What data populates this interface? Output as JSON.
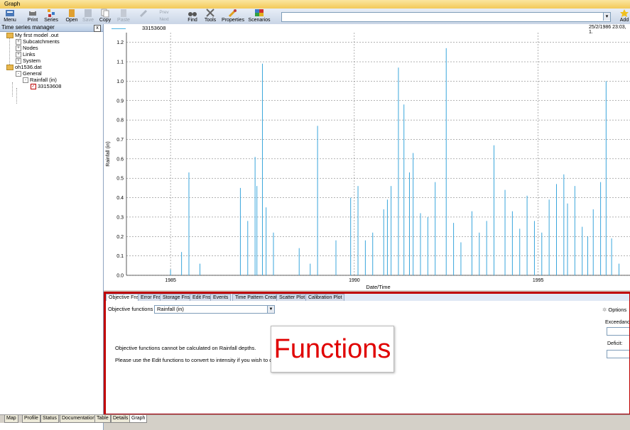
{
  "window": {
    "title": "Graph"
  },
  "toolbar": {
    "buttons": [
      {
        "label": "Menu",
        "icon": "menu-icon"
      },
      {
        "label": "Print",
        "icon": "print-icon"
      },
      {
        "label": "Series",
        "icon": "series-icon"
      },
      {
        "label": "Open",
        "icon": "open-icon"
      },
      {
        "label": "Save",
        "icon": "save-icon"
      },
      {
        "label": "Copy",
        "icon": "copy-icon"
      },
      {
        "label": "Paste",
        "icon": "paste-icon"
      },
      {
        "label": "Find",
        "icon": "find-icon"
      },
      {
        "label": "Tools",
        "icon": "tools-icon"
      },
      {
        "label": "Properties",
        "icon": "properties-icon"
      },
      {
        "label": "Scenarios",
        "icon": "scenarios-icon"
      },
      {
        "label": "Add",
        "icon": "add-star-icon"
      }
    ],
    "prev_label": "Prev",
    "next_label": "Next",
    "search_value": ""
  },
  "tree_panel": {
    "title": "Time series manager",
    "close": "x",
    "nodes": [
      {
        "label": "My first model .out",
        "expander": "",
        "icon": "folder"
      },
      {
        "label": "Subcatchments",
        "expander": "+"
      },
      {
        "label": "Nodes",
        "expander": "+"
      },
      {
        "label": "Links",
        "expander": "+"
      },
      {
        "label": "System",
        "expander": "+"
      },
      {
        "label": "oh1536.dat",
        "expander": "",
        "icon": "folder"
      },
      {
        "label": "General",
        "expander": "-"
      },
      {
        "label": "Rainfall (in)",
        "expander": "-"
      },
      {
        "label": "33153608",
        "checked": true
      }
    ]
  },
  "chart_header": {
    "series_name": "33153608",
    "date_text": "25/2/1986 23:03, 1."
  },
  "chart_data": {
    "type": "line",
    "xlabel": "Date/Time",
    "ylabel": "Rainfall (in)",
    "xlim": [
      1983.8,
      1997.5
    ],
    "ylim": [
      0,
      1.25
    ],
    "x_ticks": [
      1985,
      1990,
      1995
    ],
    "y_ticks": [
      0.0,
      0.1,
      0.2,
      0.3,
      0.4,
      0.5,
      0.6,
      0.7,
      0.8,
      0.9,
      1.0,
      1.1,
      1.2
    ],
    "grid": true,
    "series": [
      {
        "name": "33153608",
        "color": "#3aa6dc",
        "spikes": [
          [
            1985.0,
            0.03
          ],
          [
            1985.3,
            0.12
          ],
          [
            1985.5,
            0.53
          ],
          [
            1985.8,
            0.06
          ],
          [
            1986.9,
            0.45
          ],
          [
            1987.1,
            0.28
          ],
          [
            1987.3,
            0.61
          ],
          [
            1987.35,
            0.46
          ],
          [
            1987.5,
            1.09
          ],
          [
            1987.6,
            0.35
          ],
          [
            1987.8,
            0.22
          ],
          [
            1988.5,
            0.14
          ],
          [
            1988.8,
            0.06
          ],
          [
            1989.0,
            0.77
          ],
          [
            1989.5,
            0.18
          ],
          [
            1989.9,
            0.4
          ],
          [
            1990.1,
            0.46
          ],
          [
            1990.3,
            0.18
          ],
          [
            1990.5,
            0.22
          ],
          [
            1990.8,
            0.34
          ],
          [
            1990.9,
            0.39
          ],
          [
            1991.0,
            0.46
          ],
          [
            1991.2,
            1.07
          ],
          [
            1991.35,
            0.88
          ],
          [
            1991.5,
            0.53
          ],
          [
            1991.6,
            0.63
          ],
          [
            1991.8,
            0.32
          ],
          [
            1992.0,
            0.3
          ],
          [
            1992.2,
            0.48
          ],
          [
            1992.5,
            1.17
          ],
          [
            1992.7,
            0.27
          ],
          [
            1992.9,
            0.17
          ],
          [
            1993.2,
            0.33
          ],
          [
            1993.4,
            0.22
          ],
          [
            1993.6,
            0.28
          ],
          [
            1993.8,
            0.67
          ],
          [
            1994.1,
            0.44
          ],
          [
            1994.3,
            0.33
          ],
          [
            1994.5,
            0.24
          ],
          [
            1994.7,
            0.41
          ],
          [
            1994.9,
            0.28
          ],
          [
            1995.1,
            0.22
          ],
          [
            1995.3,
            0.39
          ],
          [
            1995.5,
            0.47
          ],
          [
            1995.7,
            0.52
          ],
          [
            1995.8,
            0.37
          ],
          [
            1996.0,
            0.46
          ],
          [
            1996.2,
            0.25
          ],
          [
            1996.35,
            0.2
          ],
          [
            1996.5,
            0.34
          ],
          [
            1996.7,
            0.48
          ],
          [
            1996.85,
            1.0
          ],
          [
            1997.0,
            0.19
          ],
          [
            1997.2,
            0.06
          ]
        ]
      }
    ]
  },
  "bottom_tabs": [
    "Objective Fns",
    "Error Fns",
    "Storage Fns",
    "Edit Fns",
    "Events",
    "Time Pattern Creator",
    "Scatter Plot",
    "Calibration Plot"
  ],
  "objective": {
    "label": "Objective functions for",
    "selected": "Rainfall (in)",
    "message1": "Objective functions cannot be calculated on Rainfall depths.",
    "message2": "Please use the Edit functions to convert to intensity if you wish to display obje",
    "options": "Options",
    "exceedance": "Exceedanc",
    "deficit": "Deficit:"
  },
  "overlay_label": "Functions",
  "status_tabs": [
    "Map",
    "Profile",
    "Status",
    "Documentation",
    "Table",
    "Details",
    "Graph"
  ],
  "colors": {
    "accent": "#3aa6dc",
    "frame": "#c00000",
    "overlay_text": "#e00000"
  }
}
